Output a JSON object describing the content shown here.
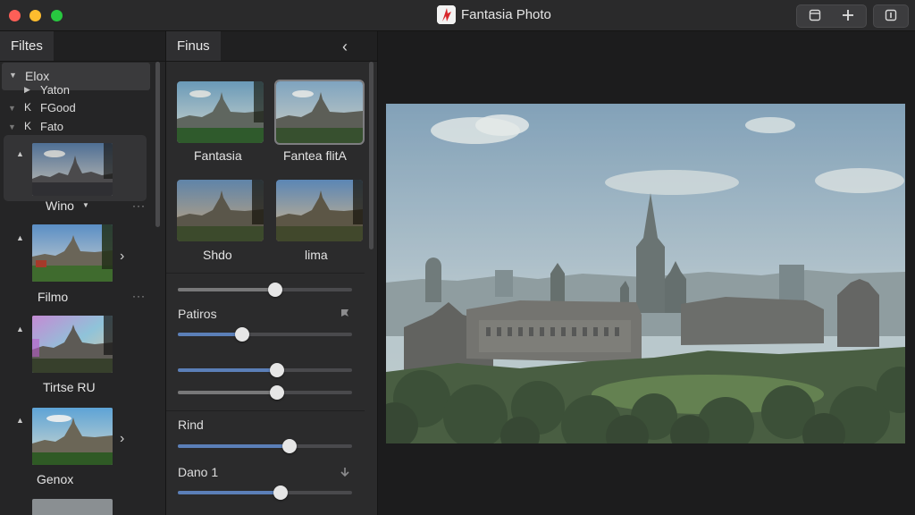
{
  "window": {
    "title": "Fantasia Photo",
    "toolbar_buttons": [
      {
        "name": "window-icon"
      },
      {
        "name": "plus-icon"
      },
      {
        "name": "sidebar-toggle-icon"
      }
    ]
  },
  "left_panel": {
    "tab_label": "Filtes",
    "tree": [
      {
        "label": "Elox",
        "expanded": true
      },
      {
        "label": "Yaton"
      },
      {
        "label": "FGood"
      },
      {
        "label": "Fato"
      }
    ],
    "items": [
      {
        "caption": "Wino",
        "has_dropdown": true,
        "more": "···",
        "active": true
      },
      {
        "caption": "Filmo",
        "more": "···"
      },
      {
        "caption": "Tirtse RU"
      },
      {
        "caption": "Genox"
      }
    ]
  },
  "mid_panel": {
    "tab_label": "Finus",
    "presets": [
      {
        "label": "Fantasia"
      },
      {
        "label": "Fantea flitA",
        "selected": true
      },
      {
        "label": "Shdo"
      },
      {
        "label": "lima"
      }
    ],
    "sections": [
      {
        "label": "Patiros"
      },
      {
        "label": "Rind"
      },
      {
        "label": "Dano 1"
      }
    ],
    "sliders": {
      "top": 0.56,
      "patiros": 0.37,
      "s2": 0.57,
      "s3": 0.57,
      "rind": 0.64,
      "dano": 0.59
    }
  },
  "colors": {
    "accent": "#5b7fb8",
    "close": "#fe5f57",
    "minimize": "#febc2e",
    "zoom": "#28c840"
  }
}
